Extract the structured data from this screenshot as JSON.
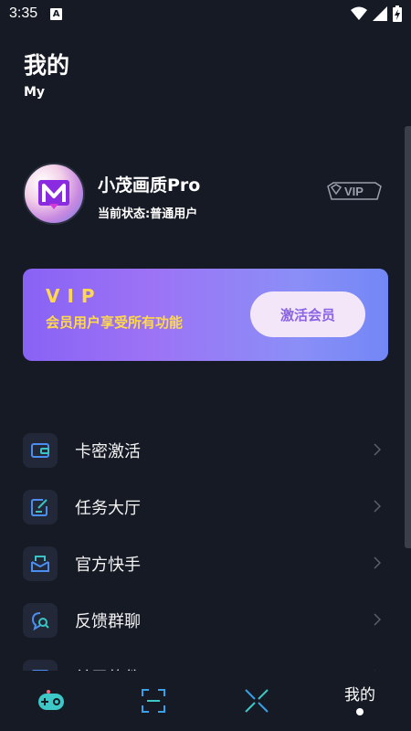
{
  "status_bar": {
    "time": "3:35",
    "notification_letter": "A"
  },
  "header": {
    "title": "我的",
    "subtitle": "My"
  },
  "profile": {
    "avatar_letter": "M",
    "name": "小茂画质Pro",
    "status": "当前状态:普通用户",
    "badge_label": "VIP"
  },
  "vip_card": {
    "title": "VIP",
    "description": "会员用户享受所有功能",
    "button_label": "激活会员"
  },
  "menu": [
    {
      "label": "卡密激活",
      "icon": "wallet-icon"
    },
    {
      "label": "任务大厅",
      "icon": "task-edit-icon"
    },
    {
      "label": "官方快手",
      "icon": "mailbox-icon"
    },
    {
      "label": "反馈群聊",
      "icon": "chat-search-icon"
    },
    {
      "label": "关于软件",
      "icon": "info-card-icon"
    }
  ],
  "bottom_nav": {
    "items": [
      {
        "icon": "gamepad-icon"
      },
      {
        "icon": "scan-icon"
      },
      {
        "icon": "cross-tools-icon"
      },
      {
        "label": "我的"
      }
    ]
  },
  "colors": {
    "background": "#161a24",
    "accent_gold": "#ffd84c",
    "card_gradient_start": "#8862f5",
    "card_gradient_end": "#7287f6",
    "icon_blue": "#4a8ff0",
    "icon_teal": "#39c3c4"
  }
}
